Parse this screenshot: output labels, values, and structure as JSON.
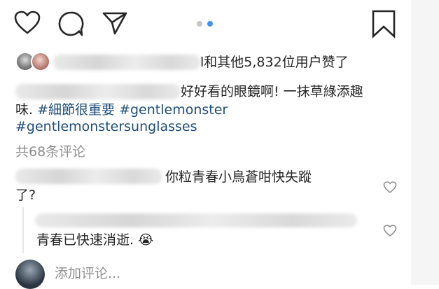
{
  "post": {
    "likes_text": "l和其他5,832位用户赞了",
    "caption": {
      "line1": "好好看的眼鏡啊! 一抹草綠添趣",
      "line2_text": "味.",
      "tag1": "#細節很重要",
      "tag2": "#gentlemonster",
      "tag3": "#gentlemonstersunglasses"
    },
    "comments_count_text": "共68条评论"
  },
  "comments": [
    {
      "line1": "你粒青春小鳥蒼咁快失蹤",
      "line2": "了?"
    },
    {
      "reply": "青春已快速消逝.",
      "emoji": "😭"
    }
  ],
  "add_comment": {
    "placeholder": "添加评论..."
  },
  "colors": {
    "link": "#1f4d7a",
    "muted": "#8e8e8e",
    "pager_active": "#3897f0",
    "pager_inactive": "#c7c7c7"
  },
  "icons": [
    "heart-icon",
    "comment-icon",
    "share-icon",
    "bookmark-icon",
    "heart-outline-small-icon",
    "crying-face-emoji"
  ]
}
